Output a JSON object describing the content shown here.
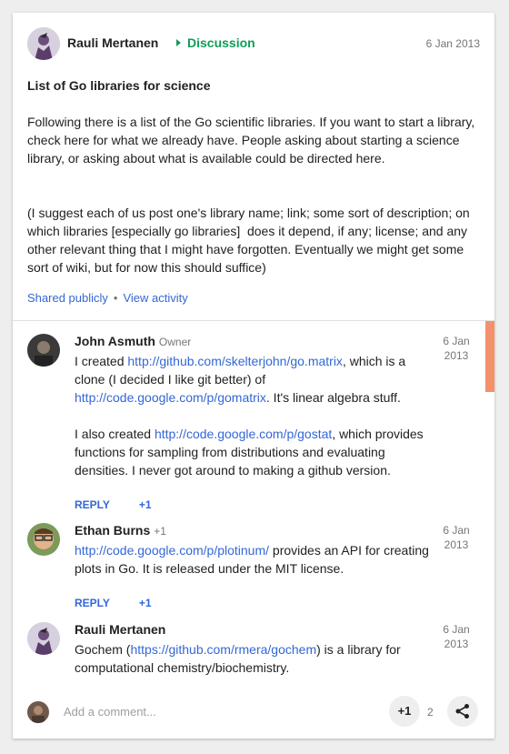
{
  "post": {
    "author": "Rauli Mertanen",
    "community": "Discussion",
    "date": "6 Jan 2013",
    "title": "List of Go libraries for science",
    "paragraph1": "Following there is a list of the Go scientific libraries. If you want to start a library, check here for what we already have. People asking about starting a science library, or asking about what is available could be directed here.",
    "paragraph2": "(I suggest each of us post one's library name; link; some sort of description; on which libraries [especially go libraries]  does it depend, if any; license; and any other relevant thing that I might have forgotten. Eventually we might get some sort of wiki, but for now this should suffice)",
    "visibility": "Shared publicly",
    "separator": "•",
    "view_activity": "View activity"
  },
  "comments": [
    {
      "author": "John Asmuth",
      "badge": "Owner",
      "date_line1": "6 Jan",
      "date_line2": "2013",
      "parts": [
        "I created ",
        "http://github.com/skelterjohn/go.matrix",
        ", which is a clone (I decided I like git better) of ",
        "http://code.google.com/p/gomatrix",
        ". It's linear algebra stuff.",
        "I also created ",
        "http://code.google.com/p/gostat",
        ", which provides functions for sampling from distributions and evaluating densities. I never got around to making a github version."
      ],
      "reply": "REPLY",
      "plus": "+1"
    },
    {
      "author": "Ethan Burns",
      "badge": "+1",
      "date_line1": "6 Jan",
      "date_line2": "2013",
      "parts": [
        "http://code.google.com/p/plotinum/",
        " provides an API for creating plots in Go.  It is released under the MIT license."
      ],
      "reply": "REPLY",
      "plus": "+1"
    },
    {
      "author": "Rauli Mertanen",
      "badge": "",
      "date_line1": "6 Jan",
      "date_line2": "2013",
      "parts": [
        "Gochem (",
        "https://github.com/rmera/gochem",
        ") is a library for computational chemistry/biochemistry."
      ]
    }
  ],
  "footer": {
    "add_comment_placeholder": "Add a comment...",
    "plus_label": "+1",
    "plus_count": "2"
  },
  "colors": {
    "accent_green": "#0f9d58",
    "link_blue": "#3367d6",
    "scroll_thumb": "#f4916c"
  }
}
